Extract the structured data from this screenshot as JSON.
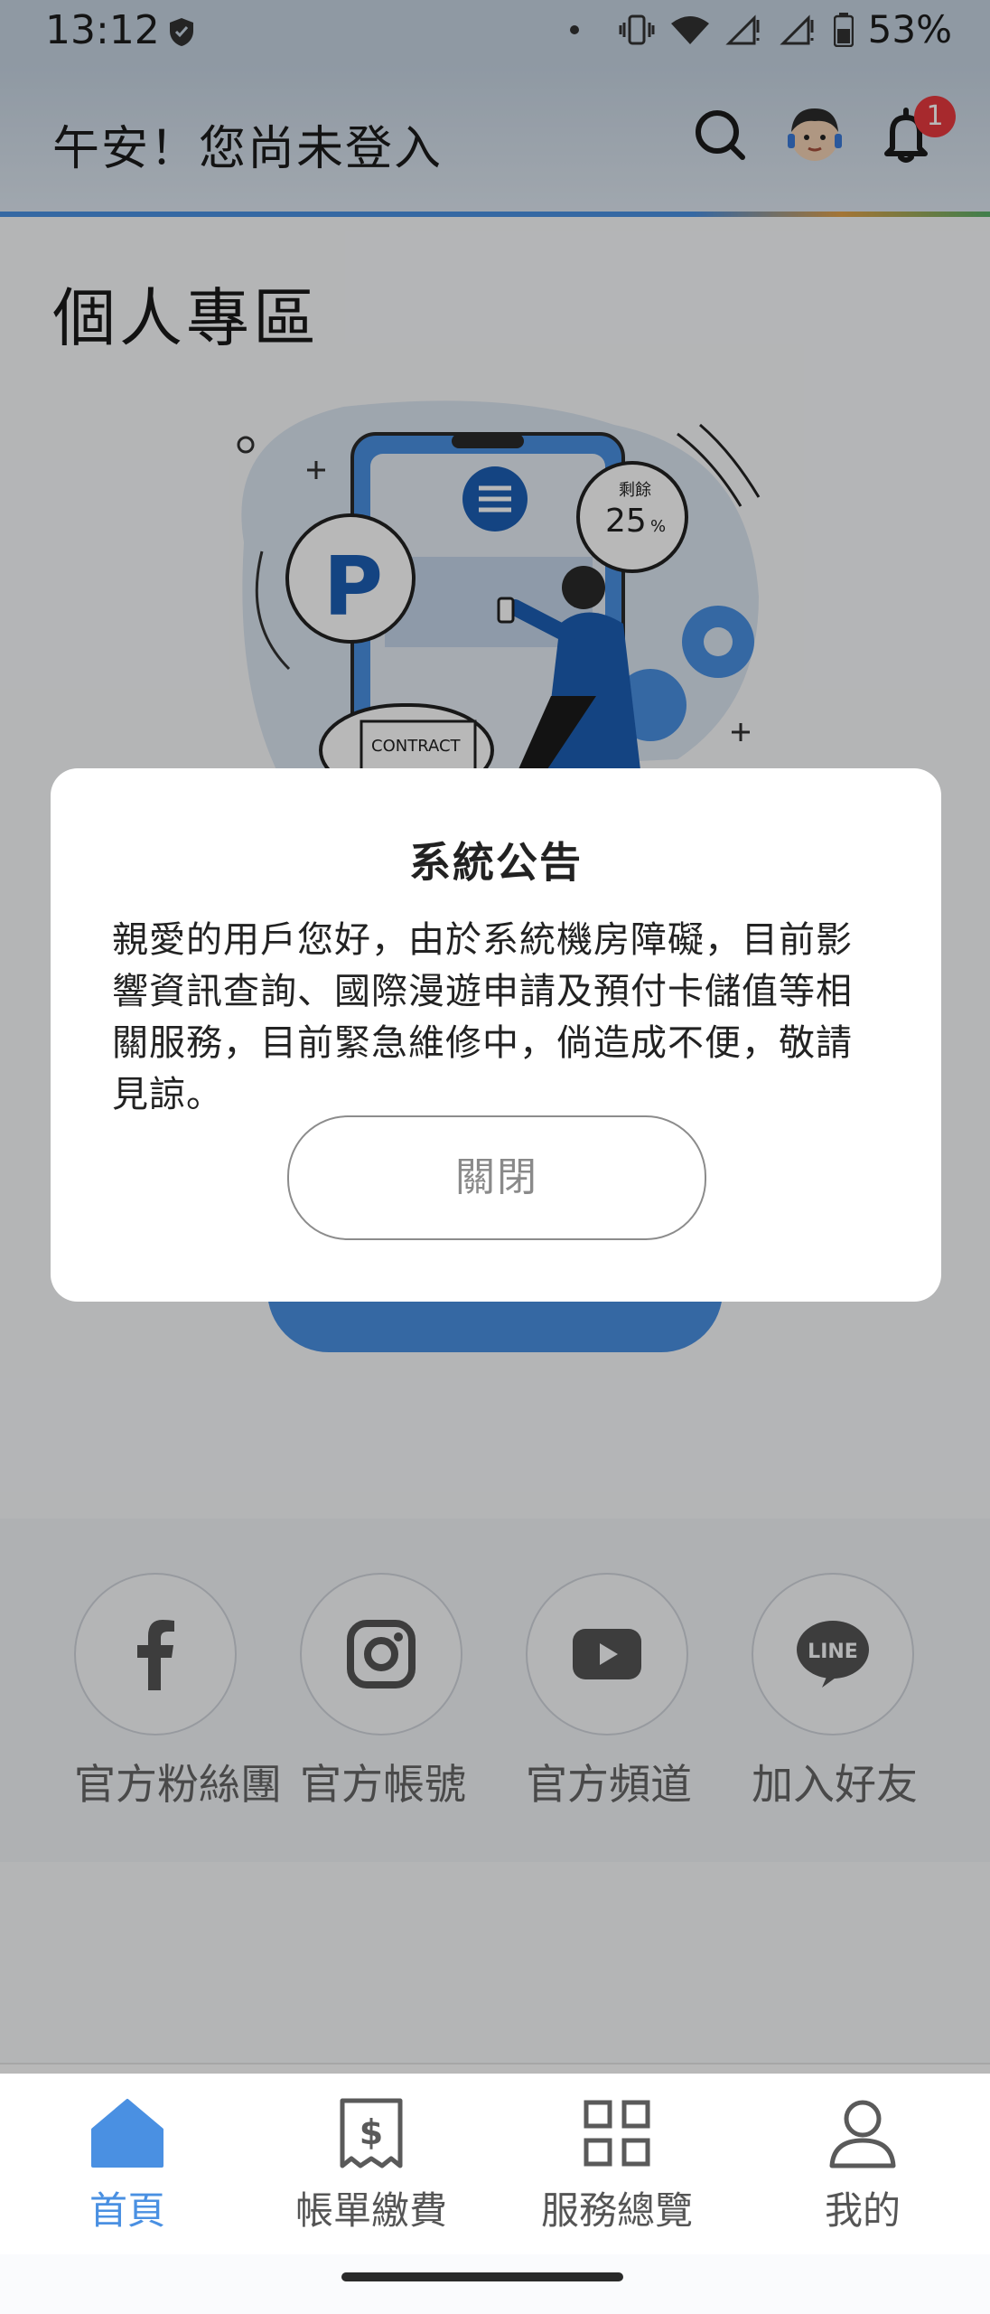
{
  "status_bar": {
    "time": "13:12",
    "battery": "53%"
  },
  "header": {
    "greeting": "午安！您尚未登入",
    "notification_count": "1"
  },
  "section": {
    "title": "個人專區"
  },
  "illustration": {
    "contract_label": "CONTRACT",
    "remaining_label": "剩餘",
    "remaining_value": "25",
    "remaining_unit": "%"
  },
  "social": [
    {
      "label": "官方粉絲團",
      "icon": "facebook-icon"
    },
    {
      "label": "官方帳號",
      "icon": "instagram-icon"
    },
    {
      "label": "官方頻道",
      "icon": "youtube-icon"
    },
    {
      "label": "加入好友",
      "icon": "line-icon",
      "icon_text": "LINE"
    }
  ],
  "tabs": [
    {
      "label": "首頁",
      "icon": "home-icon",
      "active": true
    },
    {
      "label": "帳單繳費",
      "icon": "bill-icon",
      "active": false
    },
    {
      "label": "服務總覽",
      "icon": "grid-icon",
      "active": false
    },
    {
      "label": "我的",
      "icon": "user-icon",
      "active": false
    }
  ],
  "dialog": {
    "title": "系統公告",
    "message": "親愛的用戶您好，由於系統機房障礙，目前影響資訊查詢、國際漫遊申請及預付卡儲值等相關服務，目前緊急維修中，倘造成不便，敬請見諒。",
    "close_label": "關閉"
  },
  "colors": {
    "accent": "#4a90e2",
    "badge": "#e8393f"
  }
}
